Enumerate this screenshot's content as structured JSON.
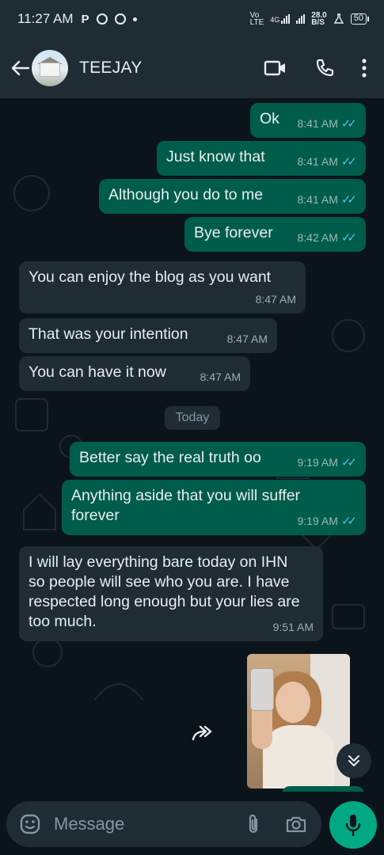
{
  "status_bar": {
    "time": "11:27 AM",
    "left_icons": [
      "P",
      "whatsapp-icon",
      "notification-icon",
      "dot"
    ],
    "network_label_top": "Vo",
    "network_label_bottom": "LTE",
    "net_type": "4G",
    "speed_top": "28.0",
    "speed_bottom": "B/S",
    "battery": "50"
  },
  "header": {
    "contact_name": "TEEJAY",
    "actions": [
      "video-call-icon",
      "voice-call-icon",
      "more-options-icon"
    ]
  },
  "messages": [
    {
      "direction": "out",
      "text": "Ok",
      "time": "8:41 AM",
      "status": "read"
    },
    {
      "direction": "out",
      "text": "Just know that",
      "time": "8:41 AM",
      "status": "read"
    },
    {
      "direction": "out",
      "text": "Although you do to me",
      "time": "8:41 AM",
      "status": "read"
    },
    {
      "direction": "out",
      "text": "Bye forever",
      "time": "8:42 AM",
      "status": "read"
    },
    {
      "direction": "in",
      "text": "You can enjoy the blog as you want",
      "time": "8:47 AM"
    },
    {
      "direction": "in",
      "text": "That was your intention",
      "time": "8:47 AM"
    },
    {
      "direction": "in",
      "text": "You can have it now",
      "time": "8:47 AM"
    },
    {
      "direction": "out",
      "text": "Better say the real truth oo",
      "time": "9:19 AM",
      "status": "read"
    },
    {
      "direction": "out",
      "text": "Anything aside that you will suffer forever",
      "time": "9:19 AM",
      "status": "read"
    },
    {
      "direction": "in",
      "text": "I will lay everything bare today on IHN so people will see who you are. I have respected long enough but your lies are too much.",
      "time": "9:51 AM"
    }
  ],
  "date_chip": "Today",
  "composer": {
    "placeholder": "Message",
    "icons": [
      "emoji-icon",
      "attach-icon",
      "camera-icon",
      "mic-icon"
    ]
  },
  "colors": {
    "background": "#0b141a",
    "header": "#1f2c34",
    "outgoing_bubble": "#005c4b",
    "incoming_bubble": "#1f2c34",
    "read_ticks": "#53bdeb",
    "accent": "#00a884"
  }
}
